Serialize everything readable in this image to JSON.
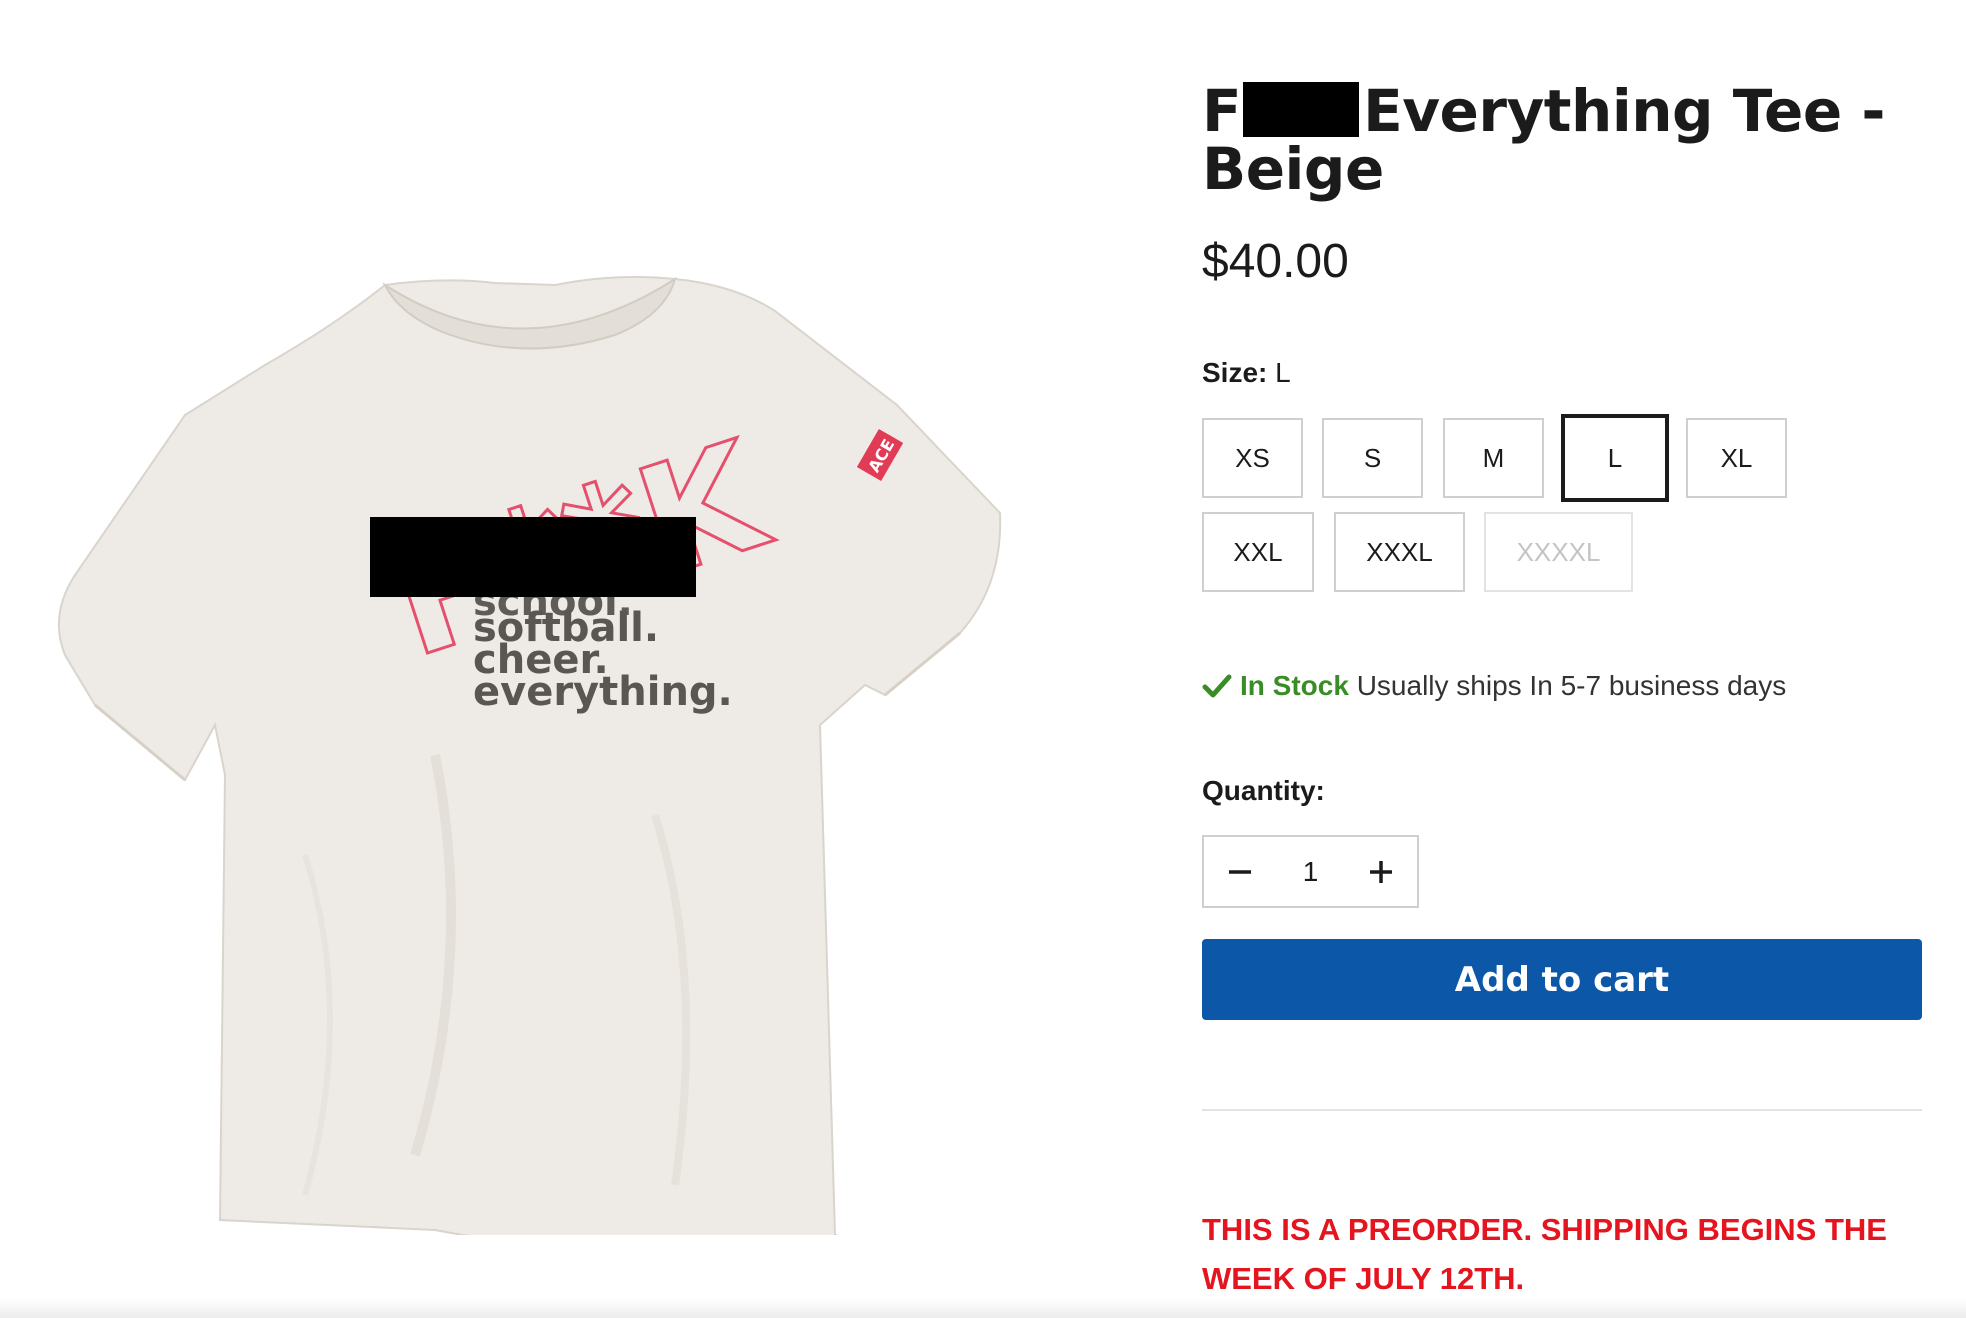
{
  "product": {
    "title_prefix": "F",
    "title_suffix": "Everything Tee - Beige",
    "price": "$40.00",
    "image": {
      "print_lines": [
        "school.",
        "softball.",
        "cheer.",
        "everything."
      ],
      "outline_word": "F**K",
      "sleeve_tag": "ACE"
    }
  },
  "size": {
    "label": "Size:",
    "selected": "L",
    "options": [
      {
        "label": "XS",
        "state": "available"
      },
      {
        "label": "S",
        "state": "available"
      },
      {
        "label": "M",
        "state": "available"
      },
      {
        "label": "L",
        "state": "selected"
      },
      {
        "label": "XL",
        "state": "available"
      },
      {
        "label": "XXL",
        "state": "available"
      },
      {
        "label": "XXXL",
        "state": "available"
      },
      {
        "label": "XXXXL",
        "state": "disabled"
      }
    ]
  },
  "stock": {
    "status": "In Stock",
    "shipping": "Usually ships In 5-7 business days",
    "icon": "check-icon"
  },
  "quantity": {
    "label": "Quantity:",
    "value": "1",
    "minus_icon": "minus-icon",
    "plus_icon": "plus-icon"
  },
  "cart": {
    "button_label": "Add to cart"
  },
  "notice": {
    "text": "THIS IS A PREORDER. SHIPPING BEGINS THE WEEK OF JULY 12TH."
  },
  "colors": {
    "accent": "#0c57a8",
    "in_stock": "#3a8d26",
    "notice": "#e4151f",
    "shirt": "#eeebe6",
    "outline_print": "#e4506e"
  }
}
